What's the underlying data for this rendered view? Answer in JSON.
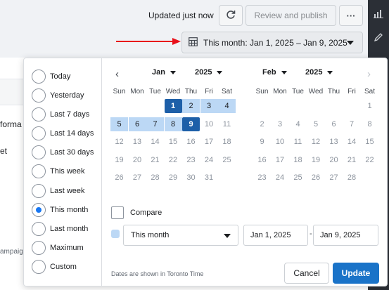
{
  "header": {
    "status": "Updated just now",
    "review_label": "Review and publish",
    "more_label": "···",
    "date_range_label": "This month: Jan 1, 2025 – Jan 9, 2025"
  },
  "background": {
    "frag_forma": "forma",
    "frag_et": "et",
    "frag_campaig": "ampaig"
  },
  "presets": [
    {
      "label": "Today",
      "selected": false
    },
    {
      "label": "Yesterday",
      "selected": false
    },
    {
      "label": "Last 7 days",
      "selected": false
    },
    {
      "label": "Last 14 days",
      "selected": false
    },
    {
      "label": "Last 30 days",
      "selected": false
    },
    {
      "label": "This week",
      "selected": false
    },
    {
      "label": "Last week",
      "selected": false
    },
    {
      "label": "This month",
      "selected": true
    },
    {
      "label": "Last month",
      "selected": false
    },
    {
      "label": "Maximum",
      "selected": false
    },
    {
      "label": "Custom",
      "selected": false
    }
  ],
  "calendar": {
    "weekdays": [
      "Sun",
      "Mon",
      "Tue",
      "Wed",
      "Thu",
      "Fri",
      "Sat"
    ],
    "left": {
      "month": "Jan",
      "year": "2025",
      "rows": [
        [
          "",
          "",
          "",
          "1",
          "2",
          "3",
          "4"
        ],
        [
          "5",
          "6",
          "7",
          "8",
          "9",
          "10",
          "11"
        ],
        [
          "12",
          "13",
          "14",
          "15",
          "16",
          "17",
          "18"
        ],
        [
          "19",
          "20",
          "21",
          "22",
          "23",
          "24",
          "25"
        ],
        [
          "26",
          "27",
          "28",
          "29",
          "30",
          "31",
          ""
        ]
      ],
      "range_start": 1,
      "range_end": 9
    },
    "right": {
      "month": "Feb",
      "year": "2025",
      "rows": [
        [
          "",
          "",
          "",
          "",
          "",
          "",
          "1"
        ],
        [
          "2",
          "3",
          "4",
          "5",
          "6",
          "7",
          "8"
        ],
        [
          "9",
          "10",
          "11",
          "12",
          "13",
          "14",
          "15"
        ],
        [
          "16",
          "17",
          "18",
          "19",
          "20",
          "21",
          "22"
        ],
        [
          "23",
          "24",
          "25",
          "26",
          "27",
          "28",
          ""
        ]
      ]
    }
  },
  "compare": {
    "label": "Compare",
    "checked": false
  },
  "range_select": {
    "value": "This month"
  },
  "start_date": "Jan 1, 2025",
  "end_date": "Jan 9, 2025",
  "separator": "-",
  "timezone_note": "Dates are shown in Toronto Time",
  "cancel_label": "Cancel",
  "update_label": "Update",
  "colors": {
    "accent": "#1a73c8",
    "selected_day": "#1d5fa8",
    "range_fill": "#bcd8f5",
    "arrow": "#e8101a"
  }
}
